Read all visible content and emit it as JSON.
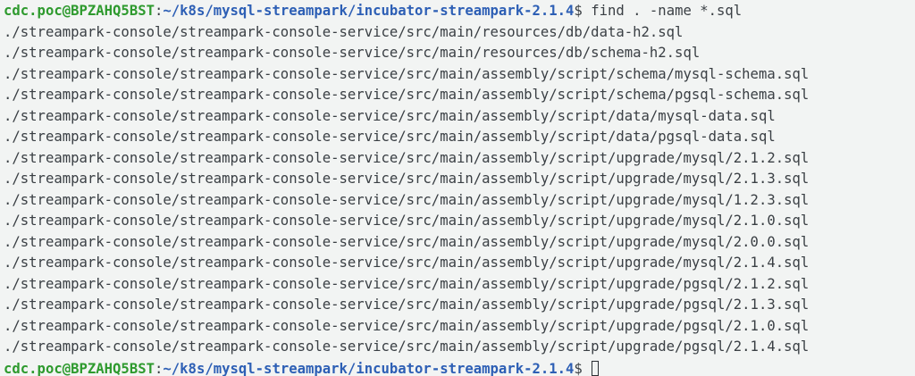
{
  "prompt": {
    "user_host": "cdc.poc@BPZAHQ5BST",
    "separator": ":",
    "cwd": "~/k8s/mysql-streampark/incubator-streampark-2.1.4",
    "symbol": "$ "
  },
  "command": "find . -name *.sql",
  "output": [
    "./streampark-console/streampark-console-service/src/main/resources/db/data-h2.sql",
    "./streampark-console/streampark-console-service/src/main/resources/db/schema-h2.sql",
    "./streampark-console/streampark-console-service/src/main/assembly/script/schema/mysql-schema.sql",
    "./streampark-console/streampark-console-service/src/main/assembly/script/schema/pgsql-schema.sql",
    "./streampark-console/streampark-console-service/src/main/assembly/script/data/mysql-data.sql",
    "./streampark-console/streampark-console-service/src/main/assembly/script/data/pgsql-data.sql",
    "./streampark-console/streampark-console-service/src/main/assembly/script/upgrade/mysql/2.1.2.sql",
    "./streampark-console/streampark-console-service/src/main/assembly/script/upgrade/mysql/2.1.3.sql",
    "./streampark-console/streampark-console-service/src/main/assembly/script/upgrade/mysql/1.2.3.sql",
    "./streampark-console/streampark-console-service/src/main/assembly/script/upgrade/mysql/2.1.0.sql",
    "./streampark-console/streampark-console-service/src/main/assembly/script/upgrade/mysql/2.0.0.sql",
    "./streampark-console/streampark-console-service/src/main/assembly/script/upgrade/mysql/2.1.4.sql",
    "./streampark-console/streampark-console-service/src/main/assembly/script/upgrade/pgsql/2.1.2.sql",
    "./streampark-console/streampark-console-service/src/main/assembly/script/upgrade/pgsql/2.1.3.sql",
    "./streampark-console/streampark-console-service/src/main/assembly/script/upgrade/pgsql/2.1.0.sql",
    "./streampark-console/streampark-console-service/src/main/assembly/script/upgrade/pgsql/2.1.4.sql"
  ],
  "colors": {
    "background": "#f2f4f3",
    "text": "#3a3f44",
    "user_host": "#2e9a2e",
    "cwd": "#2d5fb5"
  }
}
